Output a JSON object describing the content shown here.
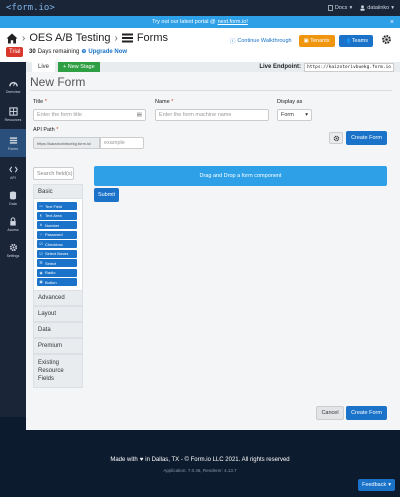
{
  "topbar": {
    "logo": "<form.io>",
    "docs_label": "Docs",
    "user_name": "dataiinko"
  },
  "announcement": {
    "text": "Try out our latest portal @",
    "link": "next.form.io!",
    "close": "×"
  },
  "project": {
    "name": "OES A/B Testing",
    "section": "Forms",
    "walkthrough_label": "Continue Walkthrough",
    "tenants_label": "Tenants",
    "teams_label": "Teams",
    "trial_badge": "Trial",
    "days_remaining": "30",
    "days_text": "Days remaining",
    "upgrade_label": "Upgrade Now"
  },
  "sidebar": {
    "items": [
      {
        "label": "Overview"
      },
      {
        "label": "Resources"
      },
      {
        "label": "Forms"
      },
      {
        "label": "API"
      },
      {
        "label": "Data"
      },
      {
        "label": "Access"
      },
      {
        "label": "Settings"
      }
    ]
  },
  "stage": {
    "live_label": "Live",
    "new_stage_label": "+ New Stage",
    "endpoint_label": "Live Endpoint:",
    "endpoint_url": "https://kaizotorivbuekg.form.io"
  },
  "form": {
    "page_title": "New Form",
    "title_label": "Title",
    "title_placeholder": "Enter the form title",
    "name_label": "Name",
    "name_placeholder": "Enter the form machine name",
    "display_label": "Display as",
    "display_value": "Form",
    "path_label": "API Path",
    "path_prefix": "https://kaizotorivbuekg.form.io/",
    "path_placeholder": "example",
    "create_label": "Create Form",
    "cancel_label": "Cancel",
    "required_mark": "*"
  },
  "builder": {
    "search_placeholder": "Search field(s)",
    "basic_label": "Basic",
    "components": [
      {
        "icon": "▭",
        "label": "Text Field"
      },
      {
        "icon": "¶",
        "label": "Text Area"
      },
      {
        "icon": "#",
        "label": "Number"
      },
      {
        "icon": "*",
        "label": "Password"
      },
      {
        "icon": "☑",
        "label": "Checkbox"
      },
      {
        "icon": "☑",
        "label": "Select Boxes"
      },
      {
        "icon": "☰",
        "label": "Select"
      },
      {
        "icon": "◉",
        "label": "Radio"
      },
      {
        "icon": "▣",
        "label": "Button"
      }
    ],
    "groups": [
      "Advanced",
      "Layout",
      "Data",
      "Premium",
      "Existing Resource Fields"
    ],
    "dropzone_text": "Drag and Drop a form component",
    "submit_label": "Submit"
  },
  "footer": {
    "made_prefix": "Made with",
    "made_suffix": "in Dallas, TX - © Form.io LLC 2021. All rights reserved",
    "version": "Application: 7.0.46, Renderer: 4.13.7",
    "feedback_label": "Feedback"
  }
}
